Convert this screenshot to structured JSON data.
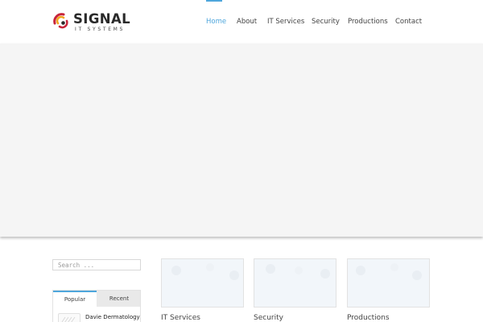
{
  "brand": {
    "name": "SIGNAL",
    "tagline": "IT SYSTEMS",
    "colors": {
      "arc_outer": "#c8243a",
      "arc_inner": "#f2a51f",
      "dot": "#2a2a2a"
    }
  },
  "nav": {
    "active_color": "#4ea6dc",
    "items": [
      {
        "label": "Home",
        "active": true
      },
      {
        "label": "About",
        "active": false
      },
      {
        "label": "IT Services",
        "active": false
      },
      {
        "label": "Security",
        "active": false
      },
      {
        "label": "Productions",
        "active": false
      },
      {
        "label": "Contact",
        "active": false
      }
    ]
  },
  "sidebar": {
    "search": {
      "placeholder": "Search ...",
      "value": ""
    },
    "tabs": [
      {
        "label": "Popular",
        "active": true
      },
      {
        "label": "Recent",
        "active": false
      }
    ],
    "posts": [
      {
        "title": "Davie Dermatology"
      }
    ]
  },
  "services": [
    {
      "label": "IT Services"
    },
    {
      "label": "Security"
    },
    {
      "label": "Productions"
    }
  ]
}
